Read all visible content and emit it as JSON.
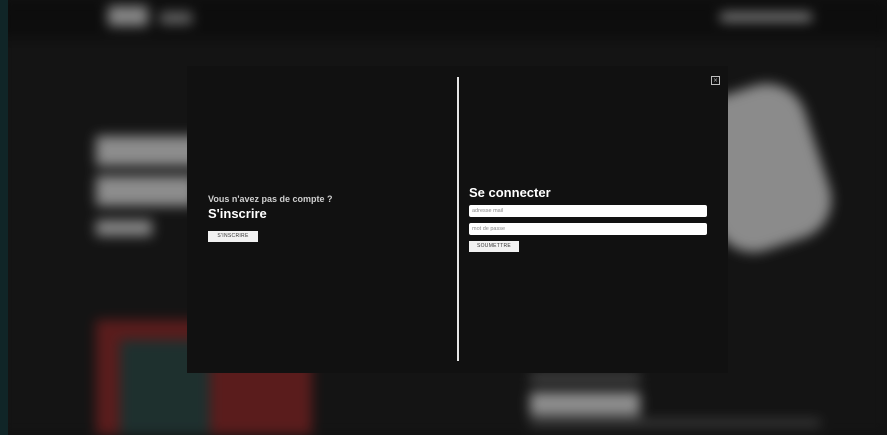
{
  "modal": {
    "close_icon_glyph": "×",
    "signup": {
      "prompt": "Vous n'avez pas de compte ?",
      "title": "S'inscrire",
      "button_label": "S'INSCRIRE"
    },
    "login": {
      "title": "Se connecter",
      "email_placeholder": "adresse mail",
      "password_placeholder": "mot de passe",
      "submit_label": "SOUMETTRE"
    }
  },
  "colors": {
    "modal_background": "#111111",
    "overlay_dim": "#000000",
    "accent_edge": "#1a3a3c"
  },
  "icons": {
    "close": "close-icon"
  }
}
